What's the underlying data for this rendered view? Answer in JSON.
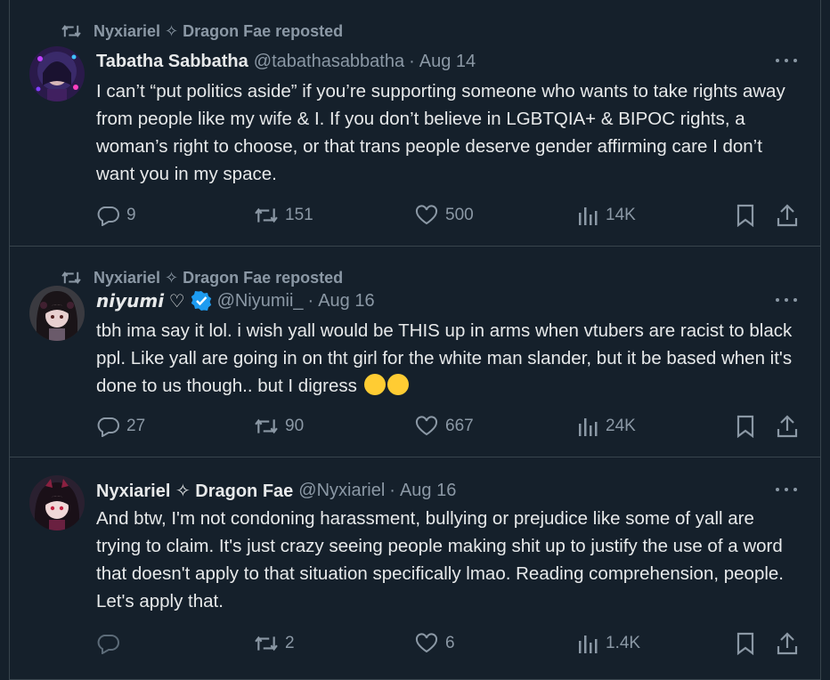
{
  "tweets": [
    {
      "reposted_by": "Nyxiariel ✧ Dragon Fae reposted",
      "name": "Tabatha Sabbatha",
      "handle": "@tabathasabbatha",
      "date": "Aug 14",
      "text": "I can’t “put politics aside” if you’re supporting someone who wants to take rights away from people like my wife & I. If you don’t believe in LGBTQIA+ & BIPOC rights, a woman’s right to choose, or that trans people deserve gender affirming care I don’t want you in my space.",
      "replies": "9",
      "reposts": "151",
      "likes": "500",
      "views": "14K"
    },
    {
      "reposted_by": "Nyxiariel ✧ Dragon Fae reposted",
      "name": "𝙣𝙞𝙮𝙪𝙢𝙞 ♡",
      "handle": "@Niyumii_",
      "date": "Aug 16",
      "verified": true,
      "text": "tbh ima say it lol. i wish yall would be THIS up in arms when vtubers are racist to black ppl. Like yall are going in on tht girl for the white man slander, but it be based when it's done to us though.. but I digress",
      "emoji": [
        "😭",
        "🫡"
      ],
      "replies": "27",
      "reposts": "90",
      "likes": "667",
      "views": "24K"
    },
    {
      "name": "Nyxiariel ✧ Dragon Fae",
      "handle": "@Nyxiariel",
      "date": "Aug 16",
      "text": "And btw, I'm not condoning harassment, bullying or prejudice like some of yall are trying to claim. It's just crazy seeing people making shit up to justify the use of a word that doesn't apply to that situation specifically lmao. Reading comprehension, people. Let's apply that.",
      "replies": "",
      "reposts": "2",
      "likes": "6",
      "views": "1.4K"
    }
  ],
  "colors": {
    "background": "#15202b",
    "border": "#38444d",
    "text": "#e7e9ea",
    "muted": "#8b98a5",
    "verified": "#1d9bf0"
  },
  "icons": [
    "repost-icon",
    "reply-icon",
    "like-icon",
    "views-icon",
    "bookmark-icon",
    "share-icon",
    "more-icon",
    "verified-icon"
  ]
}
